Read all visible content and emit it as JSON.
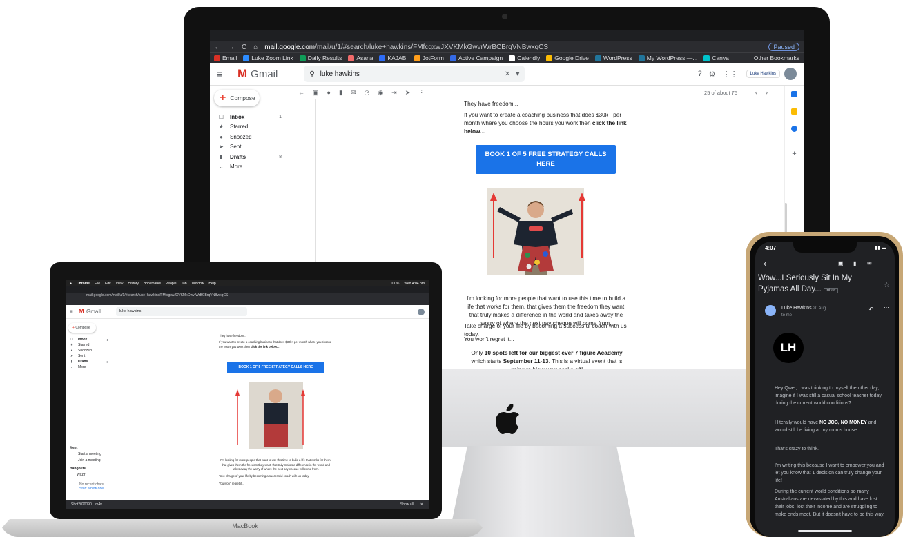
{
  "browser": {
    "url_host": "mail.google.com",
    "url_path": "/mail/u/1/#search/luke+hawkins/FMfcgxwJXVKMkGwvrWrBCBrqVNBwxqCS",
    "paused_label": "Paused",
    "other_bookmarks": "Other Bookmarks",
    "bookmarks": [
      {
        "label": "Email",
        "color": "#d93025"
      },
      {
        "label": "Luke Zoom Link",
        "color": "#2d8cff"
      },
      {
        "label": "Daily Results",
        "color": "#0f9d58"
      },
      {
        "label": "Asana",
        "color": "#f06a6a"
      },
      {
        "label": "KAJABI",
        "color": "#2e6cf6"
      },
      {
        "label": "JotForm",
        "color": "#ff9e1b"
      },
      {
        "label": "Active Campaign",
        "color": "#356ae6"
      },
      {
        "label": "Calendly",
        "color": "#ffffff"
      },
      {
        "label": "Google Drive",
        "color": "#fbbc04"
      },
      {
        "label": "WordPress",
        "color": "#21759b"
      },
      {
        "label": "My WordPress —...",
        "color": "#21759b"
      },
      {
        "label": "Canva",
        "color": "#00c4cc"
      }
    ]
  },
  "gmail": {
    "logo_text": "Gmail",
    "search_value": "luke hawkins",
    "compose_label": "Compose",
    "nav": [
      {
        "label": "Inbox",
        "count": "1",
        "icon": "inbox-icon",
        "glyph": "☐",
        "bold": true
      },
      {
        "label": "Starred",
        "count": "",
        "icon": "star-icon",
        "glyph": "★",
        "bold": false
      },
      {
        "label": "Snoozed",
        "count": "",
        "icon": "clock-icon",
        "glyph": "●",
        "bold": false
      },
      {
        "label": "Sent",
        "count": "",
        "icon": "send-icon",
        "glyph": "➤",
        "bold": false
      },
      {
        "label": "Drafts",
        "count": "8",
        "icon": "draft-icon",
        "glyph": "▮",
        "bold": true
      },
      {
        "label": "More",
        "count": "",
        "icon": "chevron-down-icon",
        "glyph": "⌄",
        "bold": false
      }
    ],
    "pager": "25 of about 75",
    "account_label": "Luke Hawkins"
  },
  "email": {
    "top_line": "They have freedom...",
    "intro_text": "If you want to create a coaching business that does $30k+ per month where you choose the hours you work then ",
    "intro_bold": "click the link below...",
    "cta_label": "BOOK 1 OF 5 FREE STRATEGY CALLS HERE",
    "para1": "I'm looking for more people that want to use this time to build a life that works for them, that gives them the freedom they want, that truly makes a difference in the world and takes away the worry of where the next pay cheque will come from.",
    "para2": "Take charge of your life by becoming a successful coach with us today.",
    "para3": "You won't regret it...",
    "para4_pre": "Only ",
    "para4_bold": "10 spots left for our biggest ever 7 figure Academy",
    "para4_mid": " which starts ",
    "para4_bold2": "September 11-13",
    "para4_post": ". This is a virtual event that is going to blow your socks off!"
  },
  "macbook": {
    "menu": [
      "Chrome",
      "File",
      "Edit",
      "View",
      "History",
      "Bookmarks",
      "People",
      "Tab",
      "Window",
      "Help"
    ],
    "clock": "Wed 4:04 pm",
    "battery": "100%",
    "meet_title": "Meet",
    "meet_items": [
      "Start a meeting",
      "Join a meeting"
    ],
    "hangouts_title": "Hangouts",
    "hangouts_user": "Wazir",
    "no_chats": "No recent chats",
    "start_new": "Start a new one",
    "download_name": "Shot2020090....m4v",
    "show_all": "Show all",
    "brand": "MacBook"
  },
  "iphone": {
    "time": "4:07",
    "subject": "Wow...I Seriously Sit In My Pyjamas All Day...",
    "inbox_badge": "Inbox",
    "sender": "Luke Hawkins",
    "date": "20 Aug",
    "to": "to me",
    "logo_initials": "LH",
    "p1": "Hey Qwer,   I was thinking to myself the other day, imagine if I was still a casual school teacher today during the current world conditions?",
    "p2_pre": "I literally would have ",
    "p2_bold": "NO JOB, NO MONEY",
    "p2_post": " and would still be living at my mums house...",
    "p3": "That's crazy to think.",
    "p4": "I'm writing this because I want to empower you and let you know that 1 decision can truly change your life!",
    "p5": "During the current world conditions so many Australians are devastated by this and have lost their jobs, lost their income and are struggling to make ends meet.   But it doesn't have to be this way."
  },
  "colors": {
    "gmail_red": "#d93025",
    "cta_blue": "#1a73e8",
    "arrow_red": "#e53935",
    "phone_bg": "#202124"
  }
}
